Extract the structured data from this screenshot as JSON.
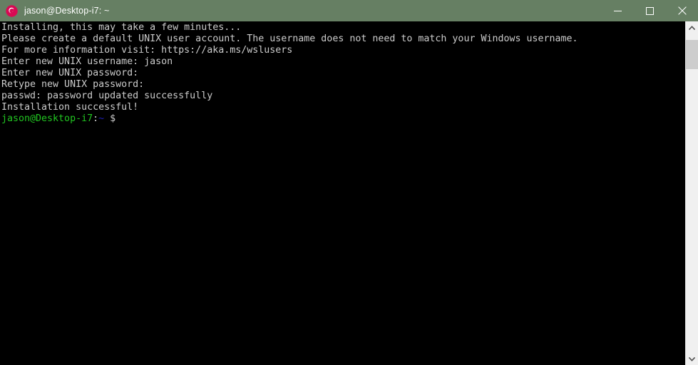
{
  "window": {
    "title": "jason@Desktop-i7: ~",
    "app_icon": "debian-swirl-icon",
    "titlebar_color": "#667f63",
    "background_color": "#000000"
  },
  "controls": {
    "minimize_label": "Minimize",
    "maximize_label": "Maximize",
    "close_label": "Close"
  },
  "terminal": {
    "text_color": "#cccccc",
    "prompt_user_color": "#21c521",
    "prompt_path_color": "#1f1fbd",
    "lines": [
      "Installing, this may take a few minutes...",
      "Please create a default UNIX user account. The username does not need to match your Windows username.",
      "For more information visit: https://aka.ms/wslusers",
      "Enter new UNIX username: jason",
      "Enter new UNIX password:",
      "Retype new UNIX password:",
      "passwd: password updated successfully",
      "Installation successful!"
    ],
    "prompt": {
      "user_host": "jason@Desktop-i7",
      "separator": ":",
      "path": "~",
      "symbol": "$"
    }
  },
  "scrollbar": {
    "up_label": "Scroll up",
    "down_label": "Scroll down",
    "thumb_label": "Scroll thumb",
    "track_color": "#f0f0f0",
    "thumb_color": "#cdcdcd"
  }
}
